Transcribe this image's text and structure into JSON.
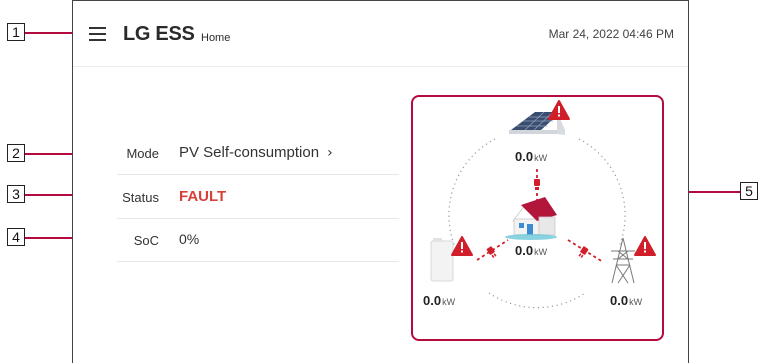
{
  "callouts": [
    "1",
    "2",
    "3",
    "4",
    "5"
  ],
  "header": {
    "brand": "LG ESS",
    "page": "Home",
    "datetime": "Mar 24, 2022 04:46 PM"
  },
  "info": {
    "mode_label": "Mode",
    "mode_value": "PV Self-consumption",
    "status_label": "Status",
    "status_value": "FAULT",
    "soc_label": "SoC",
    "soc_value": "0%"
  },
  "flow": {
    "pv_value": "0.0",
    "home_value": "0.0",
    "battery_value": "0.0",
    "grid_value": "0.0",
    "unit": "kW"
  },
  "colors": {
    "accent": "#b50a3d",
    "fault": "#d9403a",
    "warning": "#d01f2a"
  },
  "icons": [
    "menu-icon",
    "solar-panel-icon",
    "house-icon",
    "battery-icon",
    "grid-tower-icon",
    "warning-icon",
    "plug-icon"
  ]
}
